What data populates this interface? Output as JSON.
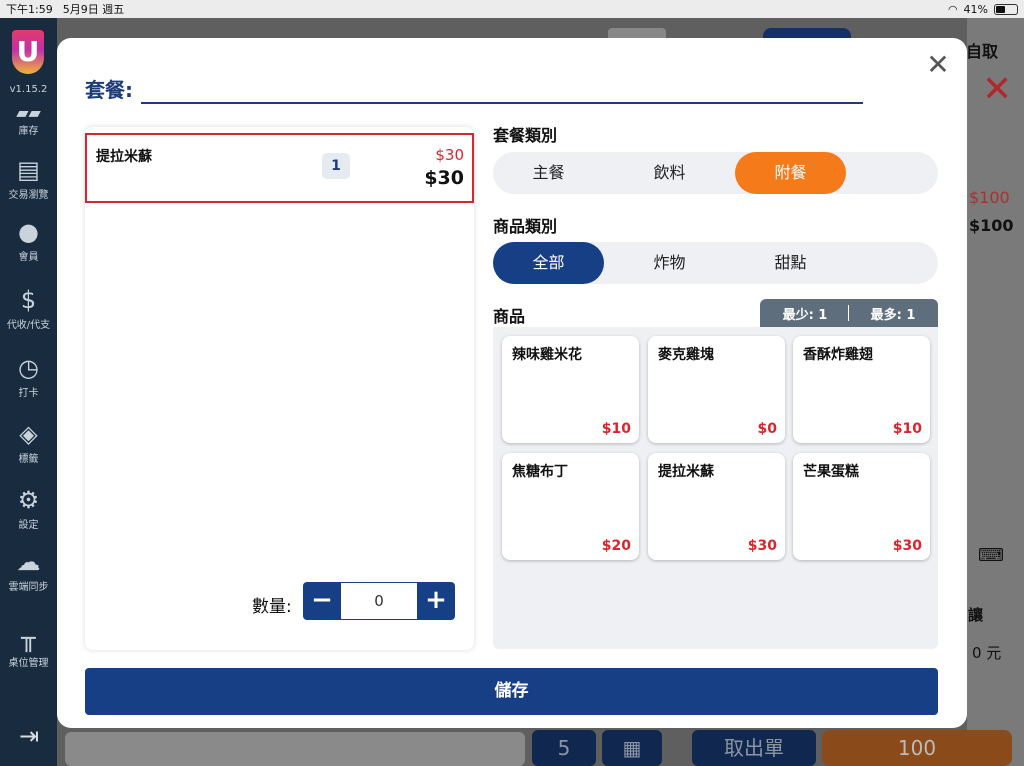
{
  "status_bar": {
    "time": "下午1:59",
    "date": "5月9日 週五",
    "battery": "41%"
  },
  "sidebar": {
    "logo_text": "U",
    "version": "v1.15.2",
    "items": [
      {
        "label": "庫存",
        "icon": "inventory-icon"
      },
      {
        "label": "交易瀏覽",
        "icon": "receipt-icon"
      },
      {
        "label": "會員",
        "icon": "member-icon"
      },
      {
        "label": "代收/代支",
        "icon": "dollar-icon"
      },
      {
        "label": "打卡",
        "icon": "clock-in-icon"
      },
      {
        "label": "標籤",
        "icon": "tag-icon"
      },
      {
        "label": "設定",
        "icon": "gear-icon"
      },
      {
        "label": "雲端同步",
        "icon": "cloud-sync-icon"
      },
      {
        "label": "桌位管理",
        "icon": "table-icon"
      }
    ]
  },
  "background": {
    "top_right_label": "自取",
    "price_red": "$100",
    "price_black": "$100",
    "discount_label": "讓",
    "discount_value": "0 元",
    "order_button": "取出單",
    "total_button": "100"
  },
  "modal": {
    "title": "套餐:",
    "selected_items": [
      {
        "name": "提拉米蘇",
        "qty": "1",
        "unit_price": "$30",
        "subtotal": "$30"
      }
    ],
    "quantity_label": "數量:",
    "quantity_value": "0",
    "combo_category_label": "套餐類別",
    "combo_categories": [
      {
        "label": "主餐",
        "active": false
      },
      {
        "label": "飲料",
        "active": false
      },
      {
        "label": "附餐",
        "active": true
      }
    ],
    "product_category_label": "商品類別",
    "product_categories": [
      {
        "label": "全部",
        "active": true
      },
      {
        "label": "炸物",
        "active": false
      },
      {
        "label": "甜點",
        "active": false
      }
    ],
    "products_label": "商品",
    "min_label": "最少: 1",
    "max_label": "最多: 1",
    "products": [
      {
        "name": "辣味雞米花",
        "price": "$10"
      },
      {
        "name": "麥克雞塊",
        "price": "$0"
      },
      {
        "name": "香酥炸雞翅",
        "price": "$10"
      },
      {
        "name": "焦糖布丁",
        "price": "$20"
      },
      {
        "name": "提拉米蘇",
        "price": "$30"
      },
      {
        "name": "芒果蛋糕",
        "price": "$30"
      }
    ],
    "save_label": "儲存"
  },
  "colors": {
    "navy": "#173f86",
    "orange": "#f47a1a",
    "red": "#d9262e",
    "sidebar": "#192c3f"
  }
}
